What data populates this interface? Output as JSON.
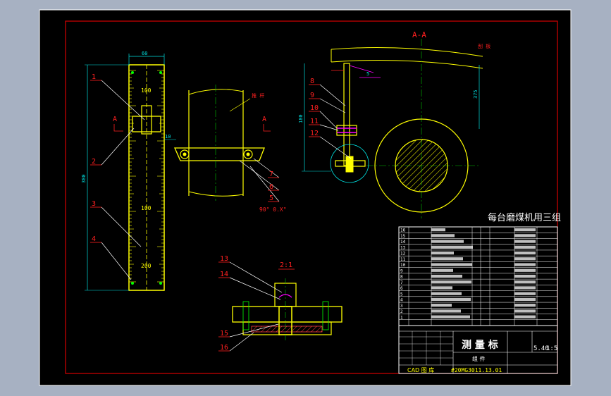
{
  "colors": {
    "background": "#a7b1c2",
    "sheet": "#000000",
    "frame": "#d40000",
    "geometry": "#ffff00",
    "dimension": "#00e0e0",
    "centerline": "#00c000",
    "balloon": "#ff2020",
    "hatch": "#ff4040",
    "table": "#ffffff",
    "accent": "#ff00ff"
  },
  "section_label": "A-A",
  "section_marks": [
    "A",
    "A"
  ],
  "balloons": [
    "1",
    "2",
    "3",
    "4",
    "5",
    "6",
    "7",
    "8",
    "9",
    "10",
    "11",
    "12",
    "13",
    "14",
    "15",
    "16"
  ],
  "ruler": {
    "ticks": [
      "100",
      "100",
      "200"
    ],
    "width_dim": "60",
    "height_dim": "380",
    "offset_dim": "10"
  },
  "labels": {
    "part_tag": "推 杆",
    "chain_note": "90° 0.X°",
    "arm_tag": "刮 板",
    "angle_dim": "5",
    "height_dim_left": "180",
    "height_dim_right": "375",
    "detail_ref": "2:1"
  },
  "title_block": {
    "machine": "每台磨煤机用三组",
    "part_name": "测 量 标",
    "scale": "5.40",
    "sheets": "1:5",
    "group_label": "组 件",
    "cad_label": "CAD 图 库",
    "drawing_no": "#20MG3011.13.01",
    "bom_rows": [
      "16",
      "15",
      "14",
      "13",
      "12",
      "11",
      "10",
      "9",
      "8",
      "7",
      "6",
      "5",
      "4",
      "3",
      "2",
      "1"
    ]
  }
}
